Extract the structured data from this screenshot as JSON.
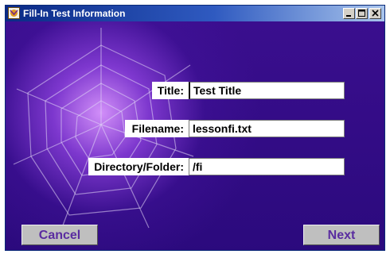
{
  "window": {
    "title": "Fill-In Test Information"
  },
  "form": {
    "title_label": "Title:",
    "title_value": "Test Title",
    "filename_label": "Filename:",
    "filename_value": "lessonfi.txt",
    "directory_label": "Directory/Folder:",
    "directory_value": "/fi"
  },
  "buttons": {
    "cancel_label": "Cancel",
    "next_label": "Next"
  },
  "colors": {
    "background": "#2a0a7a",
    "glow": "#da96ff",
    "button_text": "#5a2ca0",
    "titlebar": "#0a2a86"
  },
  "icons": [
    "app-icon",
    "minimize-icon",
    "maximize-icon",
    "close-icon",
    "spider-web-graphic"
  ]
}
